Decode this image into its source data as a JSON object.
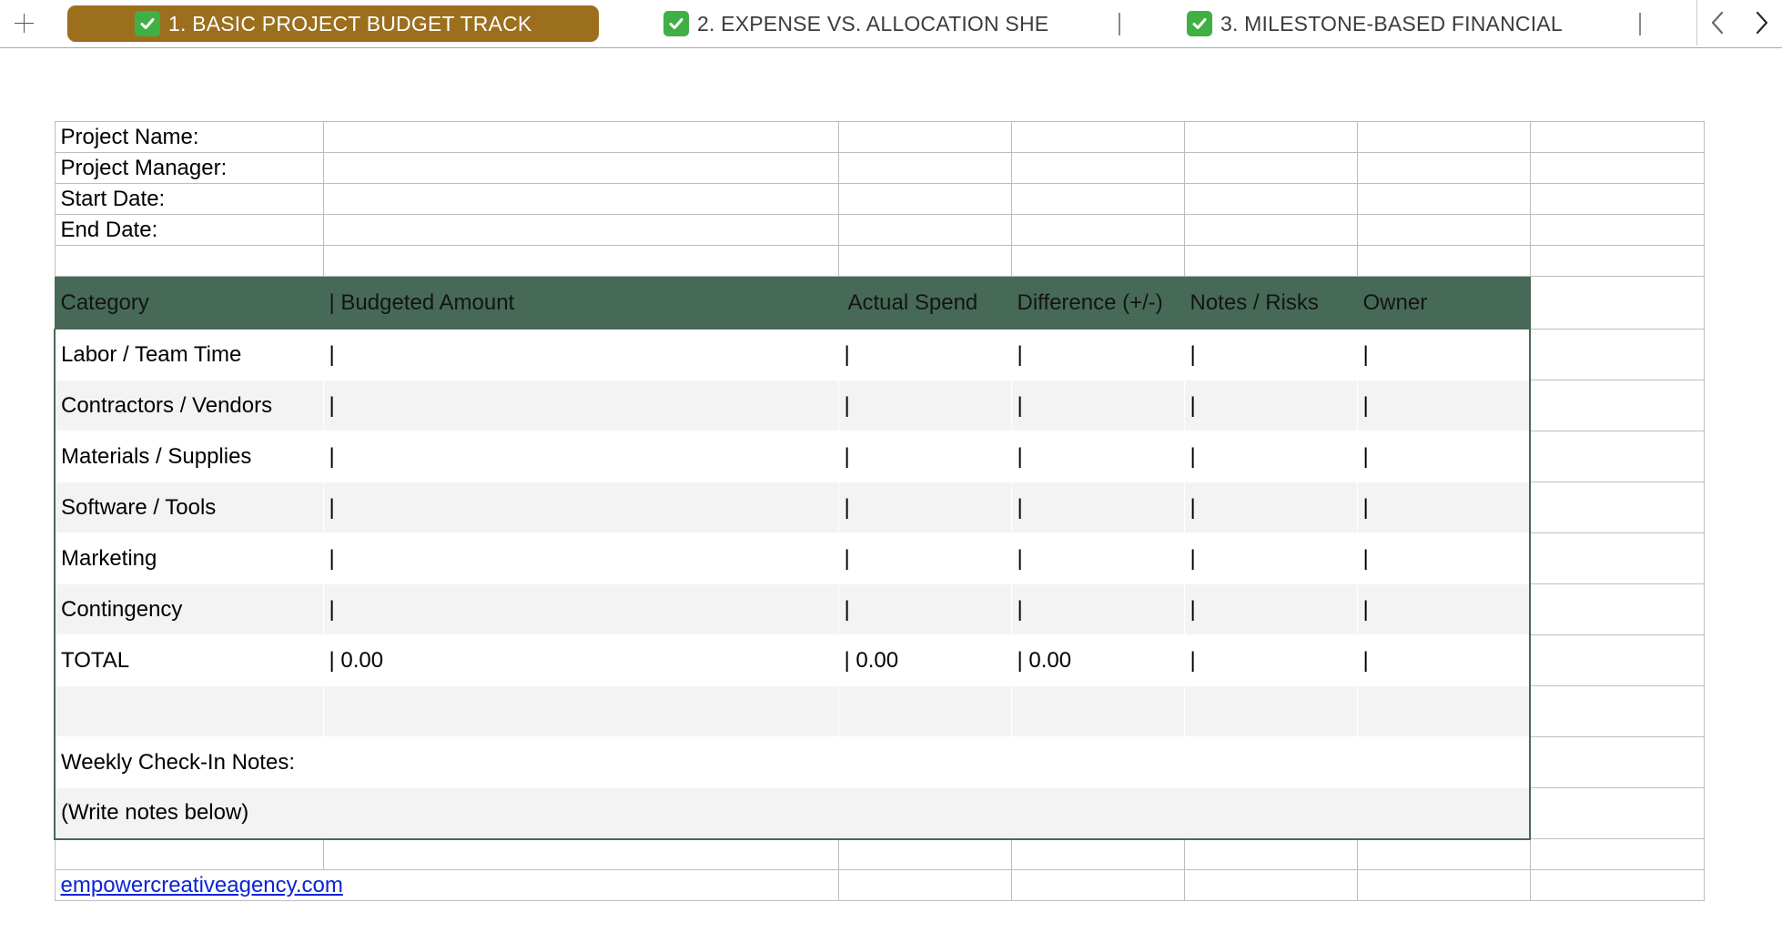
{
  "tabbar": {
    "add_label": "+",
    "tabs": [
      {
        "label": "1. BASIC PROJECT BUDGET TRACK",
        "active": true
      },
      {
        "label": "2. EXPENSE VS. ALLOCATION SHE",
        "active": false
      },
      {
        "label": "3. MILESTONE-BASED FINANCIAL",
        "active": false
      }
    ],
    "active_color": "#9b6f1e",
    "check_color": "#3fb043"
  },
  "info": {
    "project_name_label": "Project Name:",
    "project_manager_label": "Project Manager:",
    "start_date_label": "Start Date:",
    "end_date_label": "End Date:"
  },
  "table": {
    "header_color": "#466a57",
    "headers": [
      "Category",
      "| Budgeted Amount",
      "Actual Spend",
      "Difference (+/-)",
      "Notes / Risks",
      "Owner"
    ],
    "rows": [
      [
        "Labor / Team Time",
        "|",
        "|",
        "|",
        "|",
        "|"
      ],
      [
        "Contractors / Vendors",
        "|",
        "|",
        "|",
        "|",
        "|"
      ],
      [
        "Materials / Supplies",
        "|",
        "|",
        "|",
        "|",
        "|"
      ],
      [
        "Software / Tools",
        "|",
        "|",
        "|",
        "|",
        "|"
      ],
      [
        "Marketing",
        "|",
        "|",
        "|",
        "|",
        "|"
      ],
      [
        "Contingency",
        "|",
        "|",
        "|",
        "|",
        "|"
      ],
      [
        "TOTAL",
        "| 0.00",
        "| 0.00",
        "| 0.00",
        "|",
        "|"
      ]
    ],
    "weekly_notes_label": "Weekly Check-In Notes:",
    "write_notes_label": "(Write notes below)"
  },
  "footer": {
    "link_text": "empowercreativeagency.com"
  }
}
